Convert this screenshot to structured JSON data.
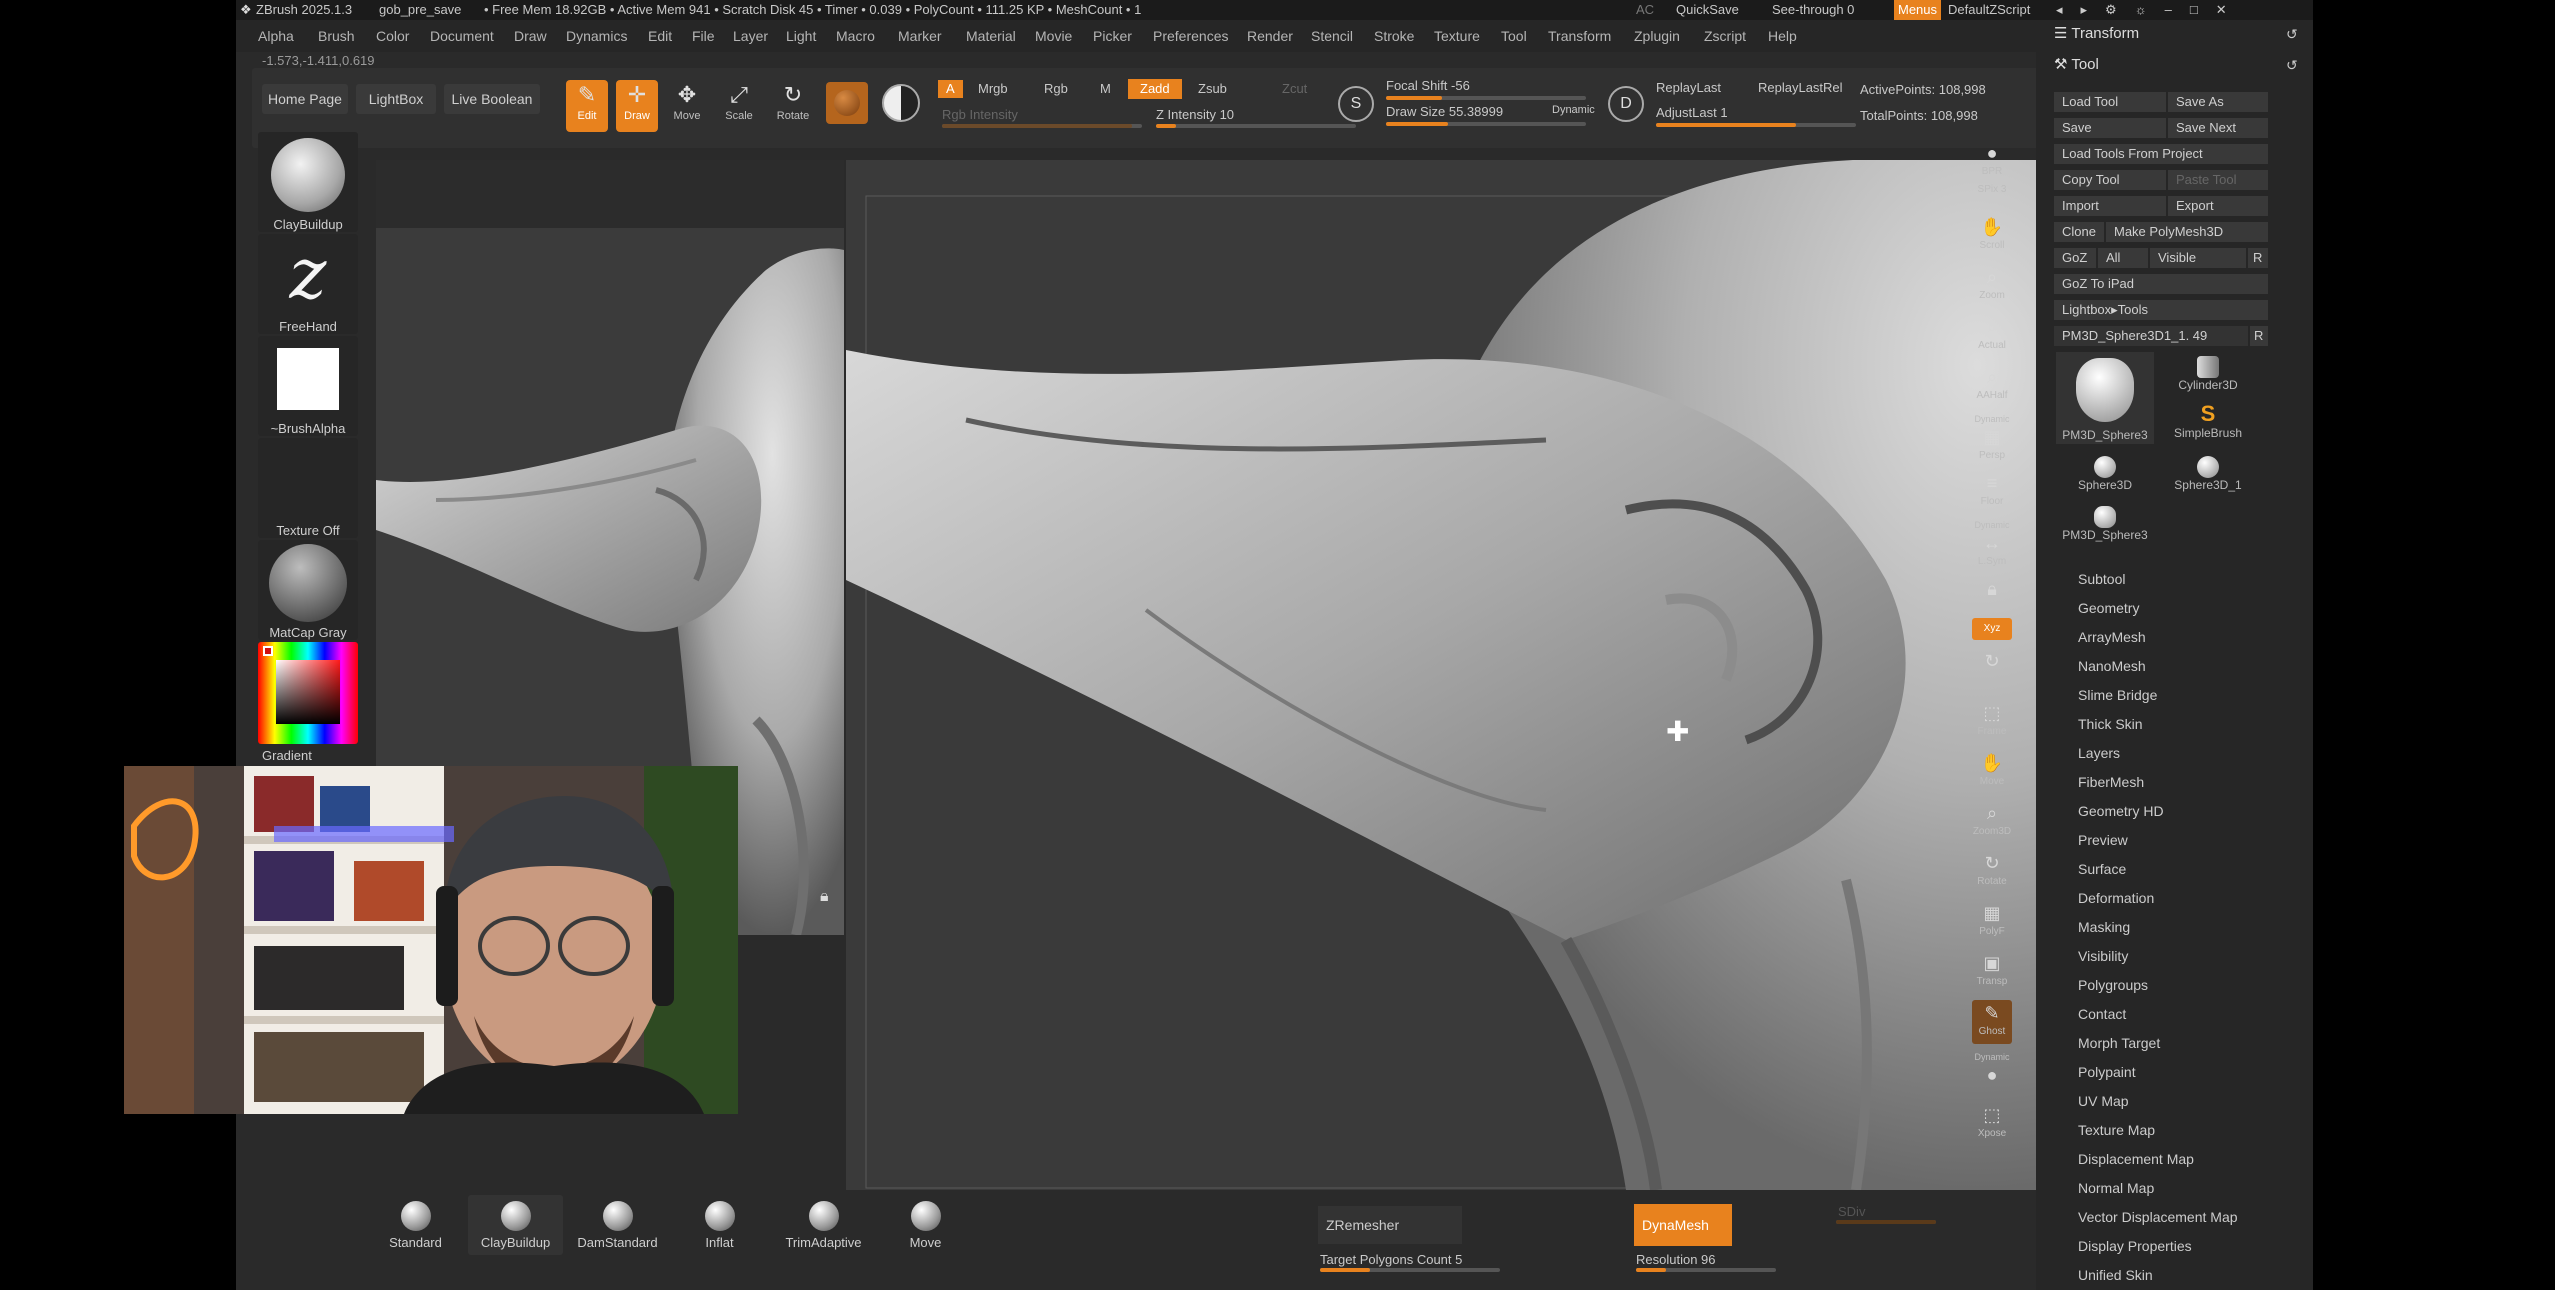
{
  "title_bar": {
    "app_version": "ZBrush 2025.1.3",
    "file_name": "gob_pre_save",
    "status": "• Free Mem 18.92GB • Active Mem 941 • Scratch Disk 45 • Timer • 0.039 • PolyCount • 111.25 KP • MeshCount • 1",
    "ac": "AC",
    "quicksave": "QuickSave",
    "see_through": "See-through  0",
    "menus": "Menus",
    "default_zscript": "DefaultZScript"
  },
  "menubar": {
    "items": [
      "Alpha",
      "Brush",
      "Color",
      "Document",
      "Draw",
      "Dynamics",
      "Edit",
      "File",
      "Layer",
      "Light",
      "Macro",
      "Marker",
      "Material",
      "Movie",
      "Picker",
      "Preferences",
      "Render",
      "Stencil",
      "Stroke",
      "Texture",
      "Tool",
      "Transform",
      "Zplugin",
      "Zscript",
      "Help"
    ]
  },
  "coords": "-1.573,-1.411,0.619",
  "toolbar": {
    "home_page": "Home Page",
    "lightbox": "LightBox",
    "live_boolean": "Live Boolean",
    "edit": "Edit",
    "draw": "Draw",
    "move": "Move",
    "scale": "Scale",
    "rotate": "Rotate",
    "a_label": "A",
    "mrgb": "Mrgb",
    "rgb": "Rgb",
    "m": "M",
    "zadd": "Zadd",
    "zsub": "Zsub",
    "zcut": "Zcut",
    "rgb_intensity": "Rgb Intensity",
    "z_intensity": "Z Intensity 10",
    "z_intensity_level": 0.1,
    "focal_shift": "Focal Shift -56",
    "draw_size": "Draw Size 55.38999",
    "dynamic": "Dynamic",
    "replay_last": "ReplayLast",
    "replay_last_rel": "ReplayLastRel",
    "adjust_last": "AdjustLast 1",
    "active_points": "ActivePoints: 108,998",
    "total_points": "TotalPoints: 108,998"
  },
  "left_shelf": {
    "brush": "ClayBuildup",
    "stroke": "FreeHand",
    "alpha": "~BrushAlpha",
    "texture": "Texture Off",
    "material": "MatCap Gray",
    "gradient": "Gradient"
  },
  "right_strip": {
    "items": [
      "BPR",
      "SPix 3",
      "Scroll",
      "Zoom",
      "Actual",
      "AAHalf",
      "Persp",
      "Floor",
      "L.Sym",
      "Xyz",
      "Frame",
      "Move",
      "Zoom3D",
      "Rotate",
      "PolyF",
      "Transp",
      "Ghost",
      "Solo",
      "Xpose"
    ],
    "dynamic": "Dynamic",
    "spix": "SPix 3"
  },
  "right_panel": {
    "transform": "Transform",
    "tool": "Tool",
    "load_tool": "Load Tool",
    "save_as": "Save As",
    "save": "Save",
    "save_next": "Save Next",
    "load_tools_from_project": "Load Tools From Project",
    "copy_tool": "Copy Tool",
    "paste_tool": "Paste Tool",
    "import": "Import",
    "export": "Export",
    "clone": "Clone",
    "make_polymesh3d": "Make PolyMesh3D",
    "goz": "GoZ",
    "all": "All",
    "visible": "Visible",
    "r": "R",
    "goz_to_ipad": "GoZ To iPad",
    "lightbox_tools": "Lightbox▸Tools",
    "current_tool": "PM3D_Sphere3D1_1. 49",
    "tool_thumbs": [
      "PM3D_Sphere3",
      "Cylinder3D",
      "SimpleBrush",
      "Sphere3D",
      "Sphere3D_1",
      "PM3D_Sphere3"
    ],
    "sub_items": [
      "Subtool",
      "Geometry",
      "ArrayMesh",
      "NanoMesh",
      "Slime Bridge",
      "Thick Skin",
      "Layers",
      "FiberMesh",
      "Geometry HD",
      "Preview",
      "Surface",
      "Deformation",
      "Masking",
      "Visibility",
      "Polygroups",
      "Contact",
      "Morph Target",
      "Polypaint",
      "UV Map",
      "Texture Map",
      "Displacement Map",
      "Normal Map",
      "Vector Displacement Map",
      "Display Properties",
      "Unified Skin"
    ]
  },
  "bottom": {
    "brushes": [
      "Standard",
      "ClayBuildup",
      "DamStandard",
      "Inflat",
      "TrimAdaptive",
      "Move"
    ],
    "zremesher": "ZRemesher",
    "target_polygons": "Target Polygons Count 5",
    "dynamesh": "DynaMesh",
    "resolution": "Resolution 96",
    "sdiv": "SDiv"
  },
  "colors": {
    "accent": "#e8821e",
    "panel": "#262626",
    "background": "#2a2a2a"
  }
}
